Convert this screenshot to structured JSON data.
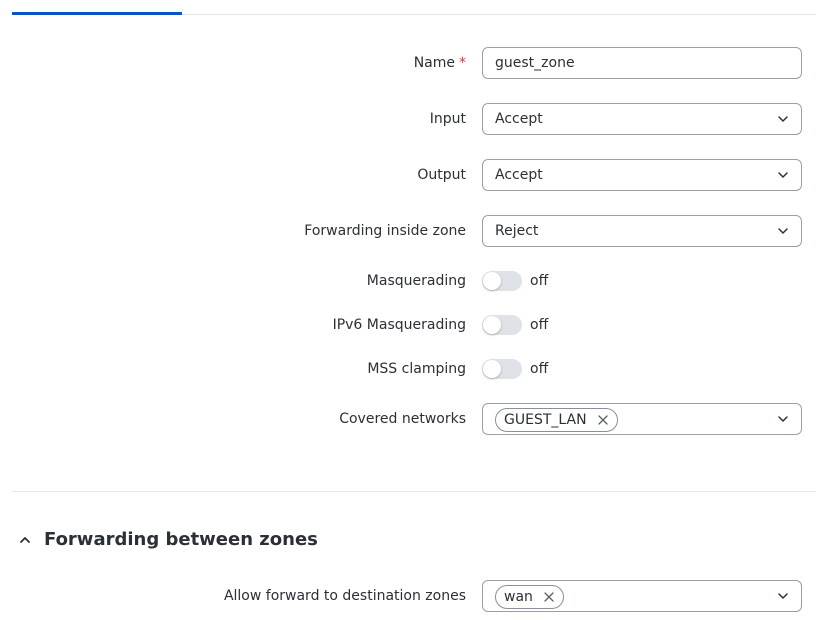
{
  "form": {
    "name": {
      "label": "Name",
      "required_mark": "*",
      "value": "guest_zone"
    },
    "input": {
      "label": "Input",
      "value": "Accept"
    },
    "output": {
      "label": "Output",
      "value": "Accept"
    },
    "forwarding_inside_zone": {
      "label": "Forwarding inside zone",
      "value": "Reject"
    },
    "masquerading": {
      "label": "Masquerading",
      "state": "off"
    },
    "ipv6_masquerading": {
      "label": "IPv6 Masquerading",
      "state": "off"
    },
    "mss_clamping": {
      "label": "MSS clamping",
      "state": "off"
    },
    "covered_networks": {
      "label": "Covered networks",
      "chips": [
        "GUEST_LAN"
      ]
    }
  },
  "forwarding_section": {
    "title": "Forwarding between zones",
    "allow_forward": {
      "label": "Allow forward to destination zones",
      "chips": [
        "wan"
      ]
    }
  },
  "colors": {
    "accent": "#0a55c4",
    "required": "#d93a3a",
    "border": "#9aa0a8",
    "toggle_off": "#dfe2e6"
  },
  "icons": {
    "select_arrow": "chevron-down-icon",
    "chip_remove": "close-icon",
    "section_toggle": "chevron-up-icon"
  }
}
